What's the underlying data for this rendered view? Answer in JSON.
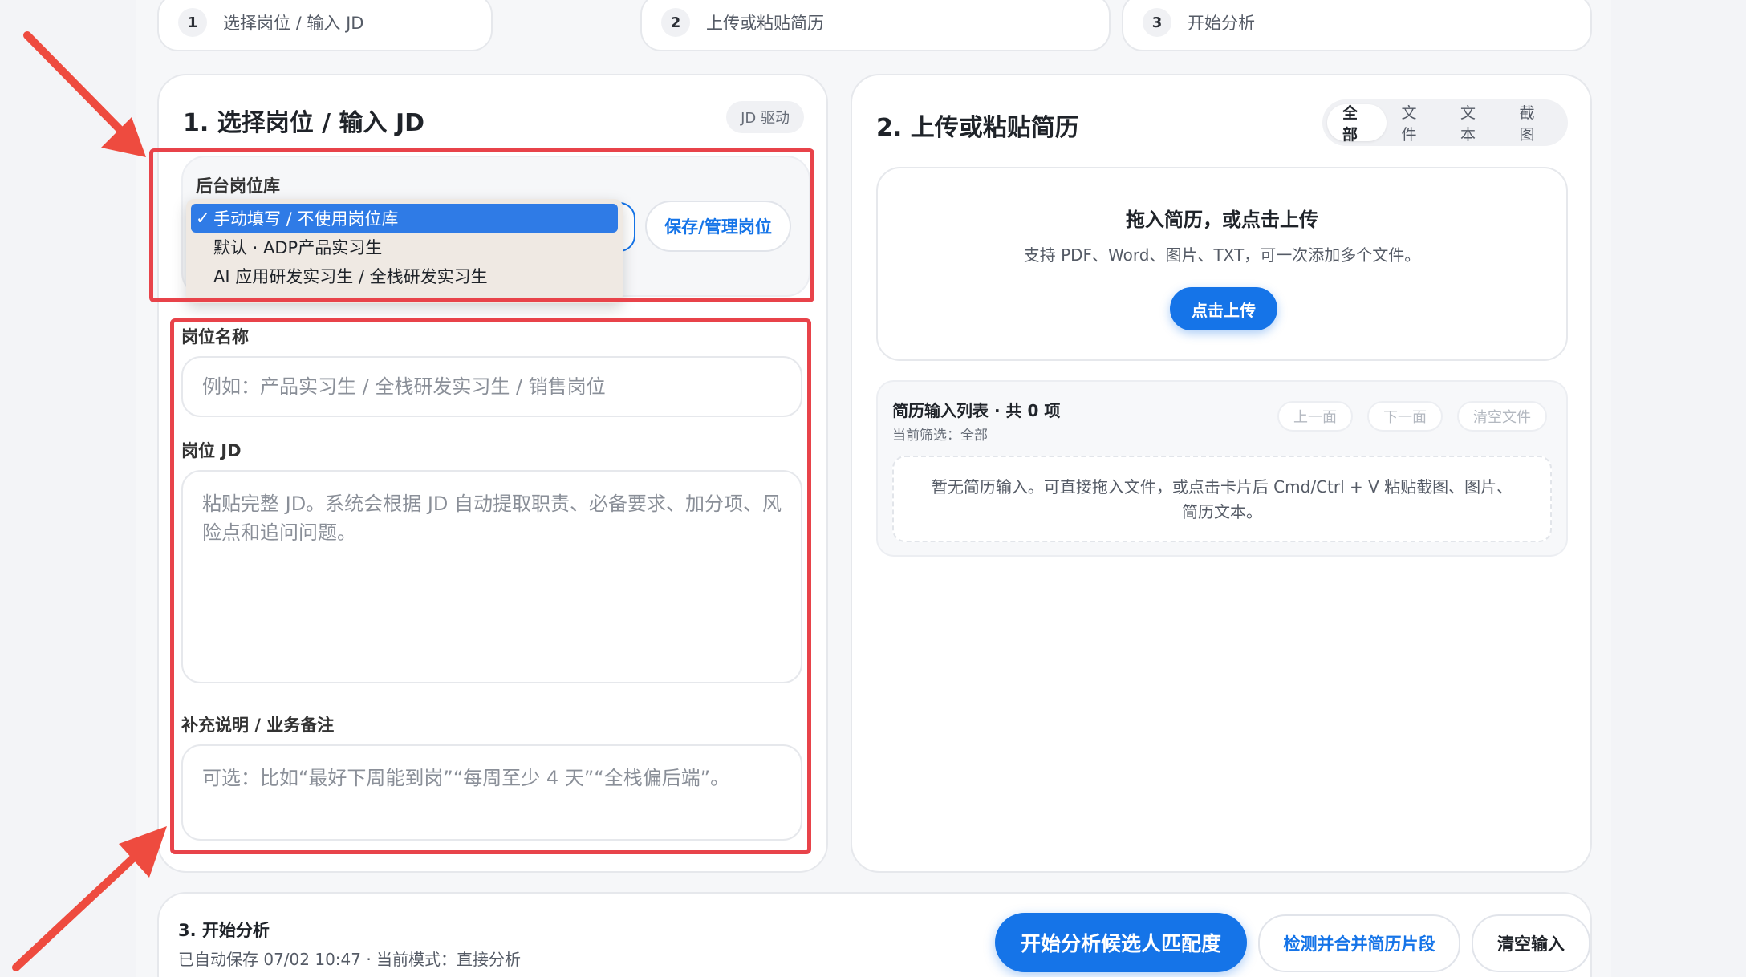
{
  "steps": [
    {
      "num": "1",
      "label": "选择岗位 / 输入 JD"
    },
    {
      "num": "2",
      "label": "上传或粘贴简历"
    },
    {
      "num": "3",
      "label": "开始分析"
    }
  ],
  "left_card": {
    "title": "1. 选择岗位 / 输入 JD",
    "badge": "JD 驱动",
    "library_label": "后台岗位库",
    "dropdown_options": [
      {
        "label": "手动填写 / 不使用岗位库",
        "selected": true
      },
      {
        "label": "默认 · ADP产品实习生",
        "selected": false
      },
      {
        "label": "AI 应用研发实习生 / 全栈研发实习生",
        "selected": false
      }
    ],
    "check_mark": "✓",
    "save_button": "保存/管理岗位",
    "job_name_label": "岗位名称",
    "job_name_placeholder": "例如：产品实习生 / 全栈研发实习生 / 销售岗位",
    "jd_label": "岗位 JD",
    "jd_placeholder": "粘贴完整 JD。系统会根据 JD 自动提取职责、必备要求、加分项、风险点和追问问题。",
    "note_label": "补充说明 / 业务备注",
    "note_placeholder": "可选：比如“最好下周能到岗”“每周至少 4 天”“全栈偏后端”。"
  },
  "right_card": {
    "title": "2. 上传或粘贴简历",
    "filters": [
      "全部",
      "文件",
      "文本",
      "截图"
    ],
    "active_filter": "全部",
    "drop_title": "拖入简历，或点击上传",
    "drop_desc": "支持 PDF、Word、图片、TXT，可一次添加多个文件。",
    "upload_button": "点击上传",
    "list_title": "简历输入列表 · 共 0 项",
    "list_filter": "当前筛选：全部",
    "prev_button": "上一面",
    "next_button": "下一面",
    "clear_files_button": "清空文件",
    "empty_text": "暂无简历输入。可直接拖入文件，或点击卡片后 Cmd/Ctrl + V 粘贴截图、图片、简历文本。"
  },
  "bottom_bar": {
    "title": "3. 开始分析",
    "status": "已自动保存 07/02 10:47 · 当前模式：直接分析",
    "analyze_button": "开始分析候选人匹配度",
    "merge_button": "检测并合并简历片段",
    "clear_button": "清空输入"
  },
  "colors": {
    "primary": "#1574e8",
    "annotation": "#e8434a",
    "dropdown_bg": "#efe9e3"
  }
}
